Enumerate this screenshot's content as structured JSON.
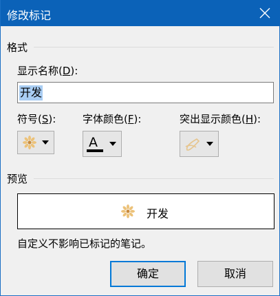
{
  "window": {
    "title": "修改标记"
  },
  "format_section": {
    "title": "格式",
    "display_name_label": "显示名称(",
    "display_name_key": "D",
    "display_name_suffix": "):",
    "display_name_value": "开发",
    "symbol_label": "符号(",
    "symbol_key": "S",
    "symbol_suffix": "):",
    "symbol_icon": "sun-flower-icon",
    "font_color_label": "字体颜色(",
    "font_color_key": "F",
    "font_color_suffix": "):",
    "font_color_value": "#000000",
    "highlight_label": "突出显示颜色(",
    "highlight_key": "H",
    "highlight_suffix": "):",
    "highlight_icon": "highlighter-icon"
  },
  "preview_section": {
    "title": "预览",
    "preview_text": "开发",
    "symbol_color": "#e8c07a"
  },
  "note": "自定义不影响已标记的笔记。",
  "buttons": {
    "ok": "确定",
    "cancel": "取消"
  },
  "colors": {
    "titlebar": "#0b62b8",
    "accent": "#0078d7",
    "selection": "#a9cdf3"
  }
}
